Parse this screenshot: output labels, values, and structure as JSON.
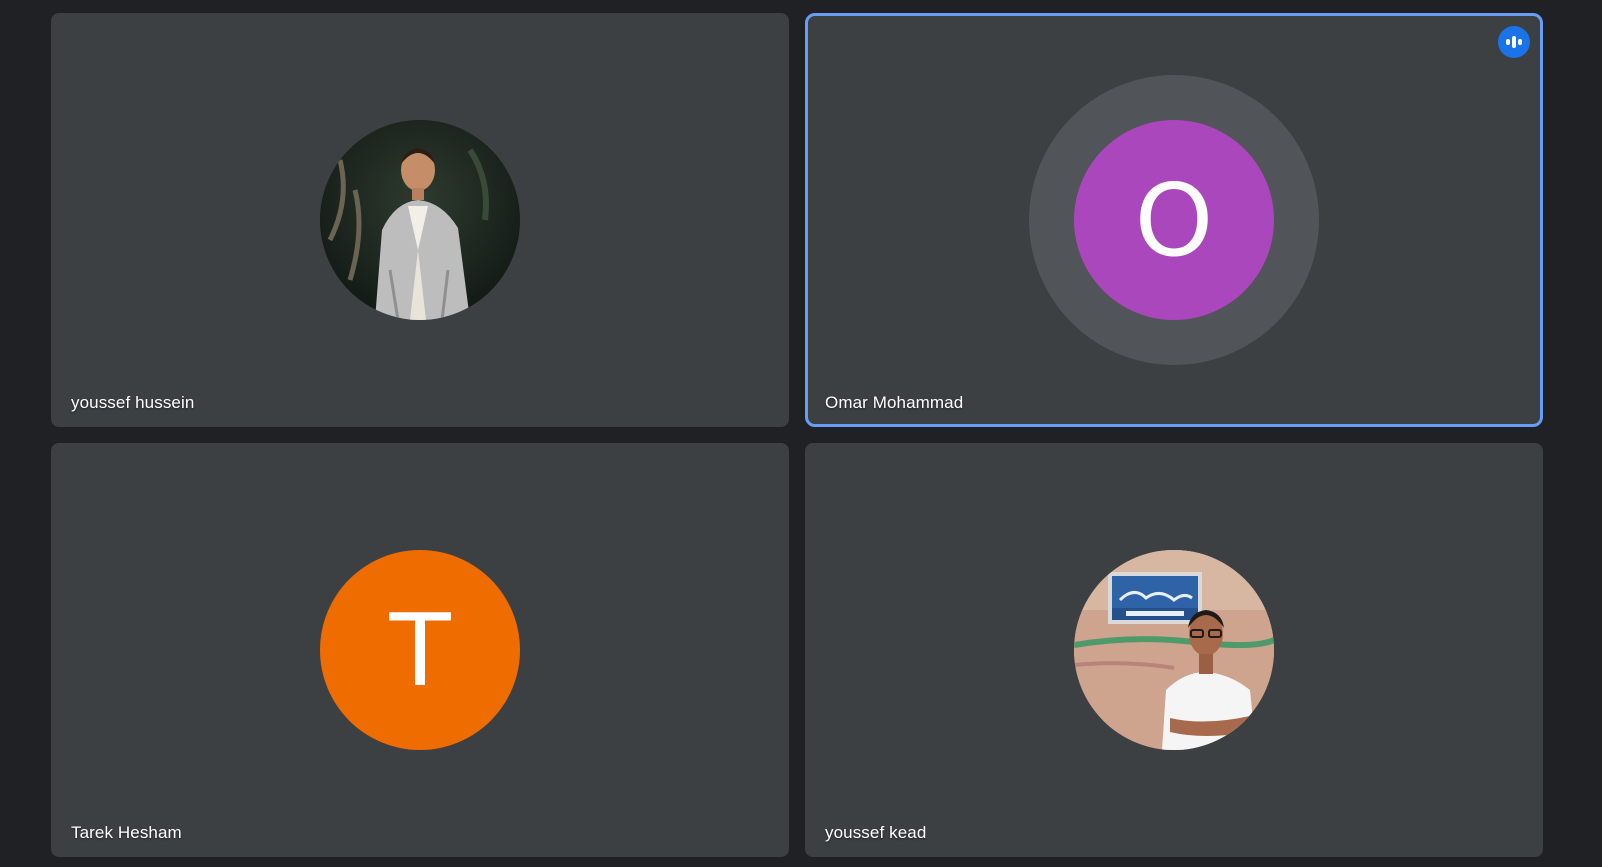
{
  "participants": [
    {
      "name": "youssef hussein",
      "avatar_type": "photo",
      "avatar_icon": "profile-photo-man-in-grey-suit",
      "speaking": false
    },
    {
      "name": "Omar Mohammad",
      "avatar_type": "letter",
      "initial": "O",
      "avatar_color": "#ab47bc",
      "speaking": true,
      "speaking_icon": "audio-level-icon",
      "highlight_color": "#669df6"
    },
    {
      "name": "Tarek Hesham",
      "avatar_type": "letter",
      "initial": "T",
      "avatar_color": "#ef6c00",
      "speaking": false
    },
    {
      "name": "youssef kead",
      "avatar_type": "photo",
      "avatar_icon": "profile-photo-man-by-street-sign",
      "speaking": false
    }
  ],
  "colors": {
    "background": "#202124",
    "tile": "#3c4043",
    "speaking_badge": "#1a73e8"
  }
}
